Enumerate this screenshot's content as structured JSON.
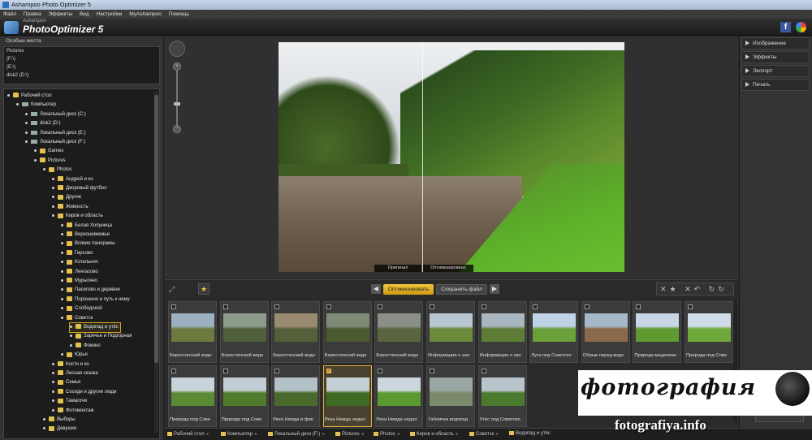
{
  "window": {
    "title": "Ashampoo Photo Optimizer 5"
  },
  "menu": [
    "Файл",
    "Правка",
    "Эффекты",
    "Вид",
    "Настройки",
    "MyAshampoo",
    "Помощь"
  ],
  "logo": {
    "sub": "Ashampoo",
    "main": "PhotoOptimizer 5"
  },
  "social": {
    "facebook": "f"
  },
  "places": {
    "title": "Особые места",
    "items": [
      "Pictures",
      "(F:\\)",
      "(E:\\)",
      "disk2 (D:\\)"
    ]
  },
  "tree": [
    {
      "label": "Рабочий стол",
      "level": 0,
      "icon": "folder"
    },
    {
      "label": "Компьютер",
      "level": 1,
      "icon": "computer"
    },
    {
      "label": "Локальный диск (C:)",
      "level": 2,
      "icon": "drive"
    },
    {
      "label": "disk2 (D:)",
      "level": 2,
      "icon": "drive"
    },
    {
      "label": "Локальный диск (E:)",
      "level": 2,
      "icon": "drive"
    },
    {
      "label": "Локальный диск (F:)",
      "level": 2,
      "icon": "drive"
    },
    {
      "label": "Games",
      "level": 3,
      "icon": "folder"
    },
    {
      "label": "Pictures",
      "level": 3,
      "icon": "folder"
    },
    {
      "label": "Photos",
      "level": 4,
      "icon": "folder"
    },
    {
      "label": "Андрей и ко",
      "level": 5,
      "icon": "folder"
    },
    {
      "label": "Дворовый футбол",
      "level": 5,
      "icon": "folder"
    },
    {
      "label": "Другие",
      "level": 5,
      "icon": "folder"
    },
    {
      "label": "Живность",
      "level": 5,
      "icon": "folder"
    },
    {
      "label": "Киров и область",
      "level": 5,
      "icon": "folder"
    },
    {
      "label": "Белая Холуница",
      "level": 6,
      "icon": "folder"
    },
    {
      "label": "Верхошижемье",
      "level": 6,
      "icon": "folder"
    },
    {
      "label": "Всякие панорамы",
      "level": 6,
      "icon": "folder"
    },
    {
      "label": "Гирсово",
      "level": 6,
      "icon": "folder"
    },
    {
      "label": "Котельнич",
      "level": 6,
      "icon": "folder"
    },
    {
      "label": "Ленгасово",
      "level": 6,
      "icon": "folder"
    },
    {
      "label": "Мурыгино",
      "level": 6,
      "icon": "folder"
    },
    {
      "label": "Пасегово и деревни",
      "level": 6,
      "icon": "folder"
    },
    {
      "label": "Порошино и путь к нему",
      "level": 6,
      "icon": "folder"
    },
    {
      "label": "Слободской",
      "level": 6,
      "icon": "folder"
    },
    {
      "label": "Советск",
      "level": 6,
      "icon": "folder"
    },
    {
      "label": "Водопад и утёс",
      "level": 7,
      "icon": "folder",
      "selected": true
    },
    {
      "label": "Заречье и Подгорная",
      "level": 7,
      "icon": "folder"
    },
    {
      "label": "Фокино",
      "level": 7,
      "icon": "folder"
    },
    {
      "label": "Юрья",
      "level": 6,
      "icon": "folder"
    },
    {
      "label": "Кости и ко",
      "level": 5,
      "icon": "folder"
    },
    {
      "label": "Лесная сказка",
      "level": 5,
      "icon": "folder"
    },
    {
      "label": "Семья",
      "level": 5,
      "icon": "folder"
    },
    {
      "label": "Соседи и другие люди",
      "level": 5,
      "icon": "folder"
    },
    {
      "label": "Тамагочи",
      "level": 5,
      "icon": "folder"
    },
    {
      "label": "Фотомонтаж",
      "level": 5,
      "icon": "folder"
    },
    {
      "label": "Выборы",
      "level": 4,
      "icon": "folder"
    },
    {
      "label": "Девушки",
      "level": 4,
      "icon": "folder"
    }
  ],
  "preview": {
    "label_original": "Оригинал",
    "label_optimized": "Оптимизировано"
  },
  "toolbar": {
    "optimize": "Оптимизировать",
    "save_file": "Сохранить файл",
    "tools": "✕★ ✕↶ ↻↻"
  },
  "thumbnails": [
    {
      "caption": "Берестянский водо",
      "colors": [
        "#9bb0c0",
        "#6b7a3f"
      ],
      "selected": false
    },
    {
      "caption": "Берестянский водо",
      "colors": [
        "#8d9c8a",
        "#4f5f3a"
      ],
      "selected": false
    },
    {
      "caption": "Берестянский водо",
      "colors": [
        "#9a8a6f",
        "#55603a"
      ],
      "selected": false
    },
    {
      "caption": "Берестянский водо",
      "colors": [
        "#7f8a78",
        "#4c5a30"
      ],
      "selected": false
    },
    {
      "caption": "Берестянский водо",
      "colors": [
        "#8b8f86",
        "#5a6540"
      ],
      "selected": false
    },
    {
      "caption": "Информация о зап",
      "colors": [
        "#b8c6d2",
        "#6b8a3a"
      ],
      "selected": false
    },
    {
      "caption": "Информация о зап",
      "colors": [
        "#a9b5bf",
        "#5d7d36"
      ],
      "selected": false
    },
    {
      "caption": "Луга под Советско",
      "colors": [
        "#bfd3e6",
        "#6aa03a"
      ],
      "selected": false
    },
    {
      "caption": "Обрыв перед водо",
      "colors": [
        "#a7b9c8",
        "#8a6a4a"
      ],
      "selected": false
    },
    {
      "caption": "Природа медалеки",
      "colors": [
        "#c7d6e4",
        "#5e9a2f"
      ],
      "selected": false
    },
    {
      "caption": "Природа под Сове",
      "colors": [
        "#d0dde8",
        "#6fa83a"
      ],
      "selected": false
    },
    {
      "caption": "Природа под Сове",
      "colors": [
        "#c8d2da",
        "#5a8a34"
      ],
      "selected": false
    },
    {
      "caption": "Природа под Сове",
      "colors": [
        "#c2ccd4",
        "#4e7c2c"
      ],
      "selected": false
    },
    {
      "caption": "Река Немда в фин",
      "colors": [
        "#b4c0c8",
        "#4a6a2c"
      ],
      "selected": false
    },
    {
      "caption": "Река Немда недал",
      "colors": [
        "#c5cfd6",
        "#3f6a24"
      ],
      "selected": true
    },
    {
      "caption": "Река Немда недал",
      "colors": [
        "#ccd6de",
        "#5a9a30"
      ],
      "selected": false
    },
    {
      "caption": "Табличка водопад",
      "colors": [
        "#9aa6a2",
        "#7a8a6a"
      ],
      "selected": false
    },
    {
      "caption": "Утёс под Советско",
      "colors": [
        "#b9c4cc",
        "#4a7a2e"
      ],
      "selected": false
    }
  ],
  "breadcrumb": [
    "Рабочий стол",
    "Компьютер",
    "Локальный диск (F:)",
    "Pictures",
    "Photos",
    "Киров и область",
    "Советск",
    "Водопад и утёс"
  ],
  "right_panel": [
    "Изображение",
    "Эффекты",
    "Экспорт",
    "Печать"
  ],
  "watermark": {
    "script": "фотография",
    "url": "fotografiya.info"
  }
}
